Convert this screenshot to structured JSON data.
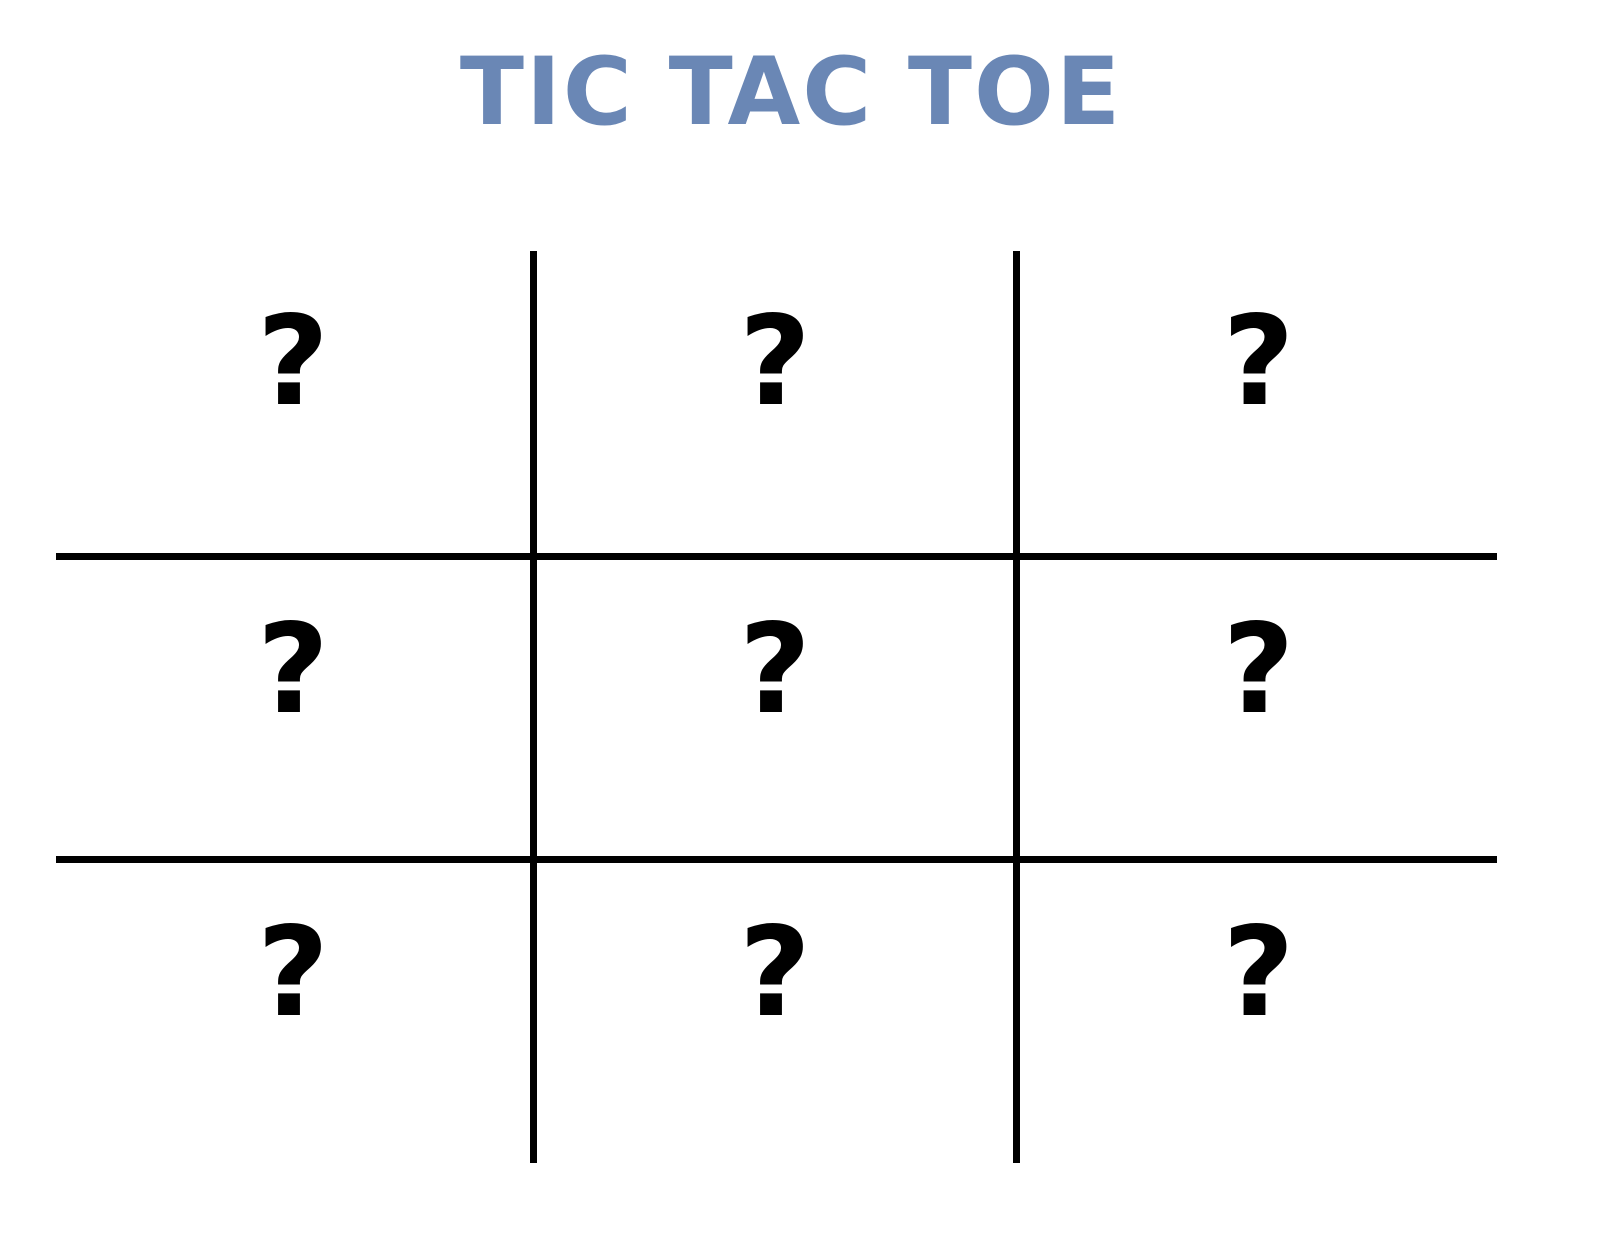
{
  "title": "TIC TAC TOE",
  "title_color": "#6a87b5",
  "board": {
    "rows": [
      [
        "?",
        "?",
        "?"
      ],
      [
        "?",
        "?",
        "?"
      ],
      [
        "?",
        "?",
        "?"
      ]
    ],
    "line_color": "#000000"
  }
}
